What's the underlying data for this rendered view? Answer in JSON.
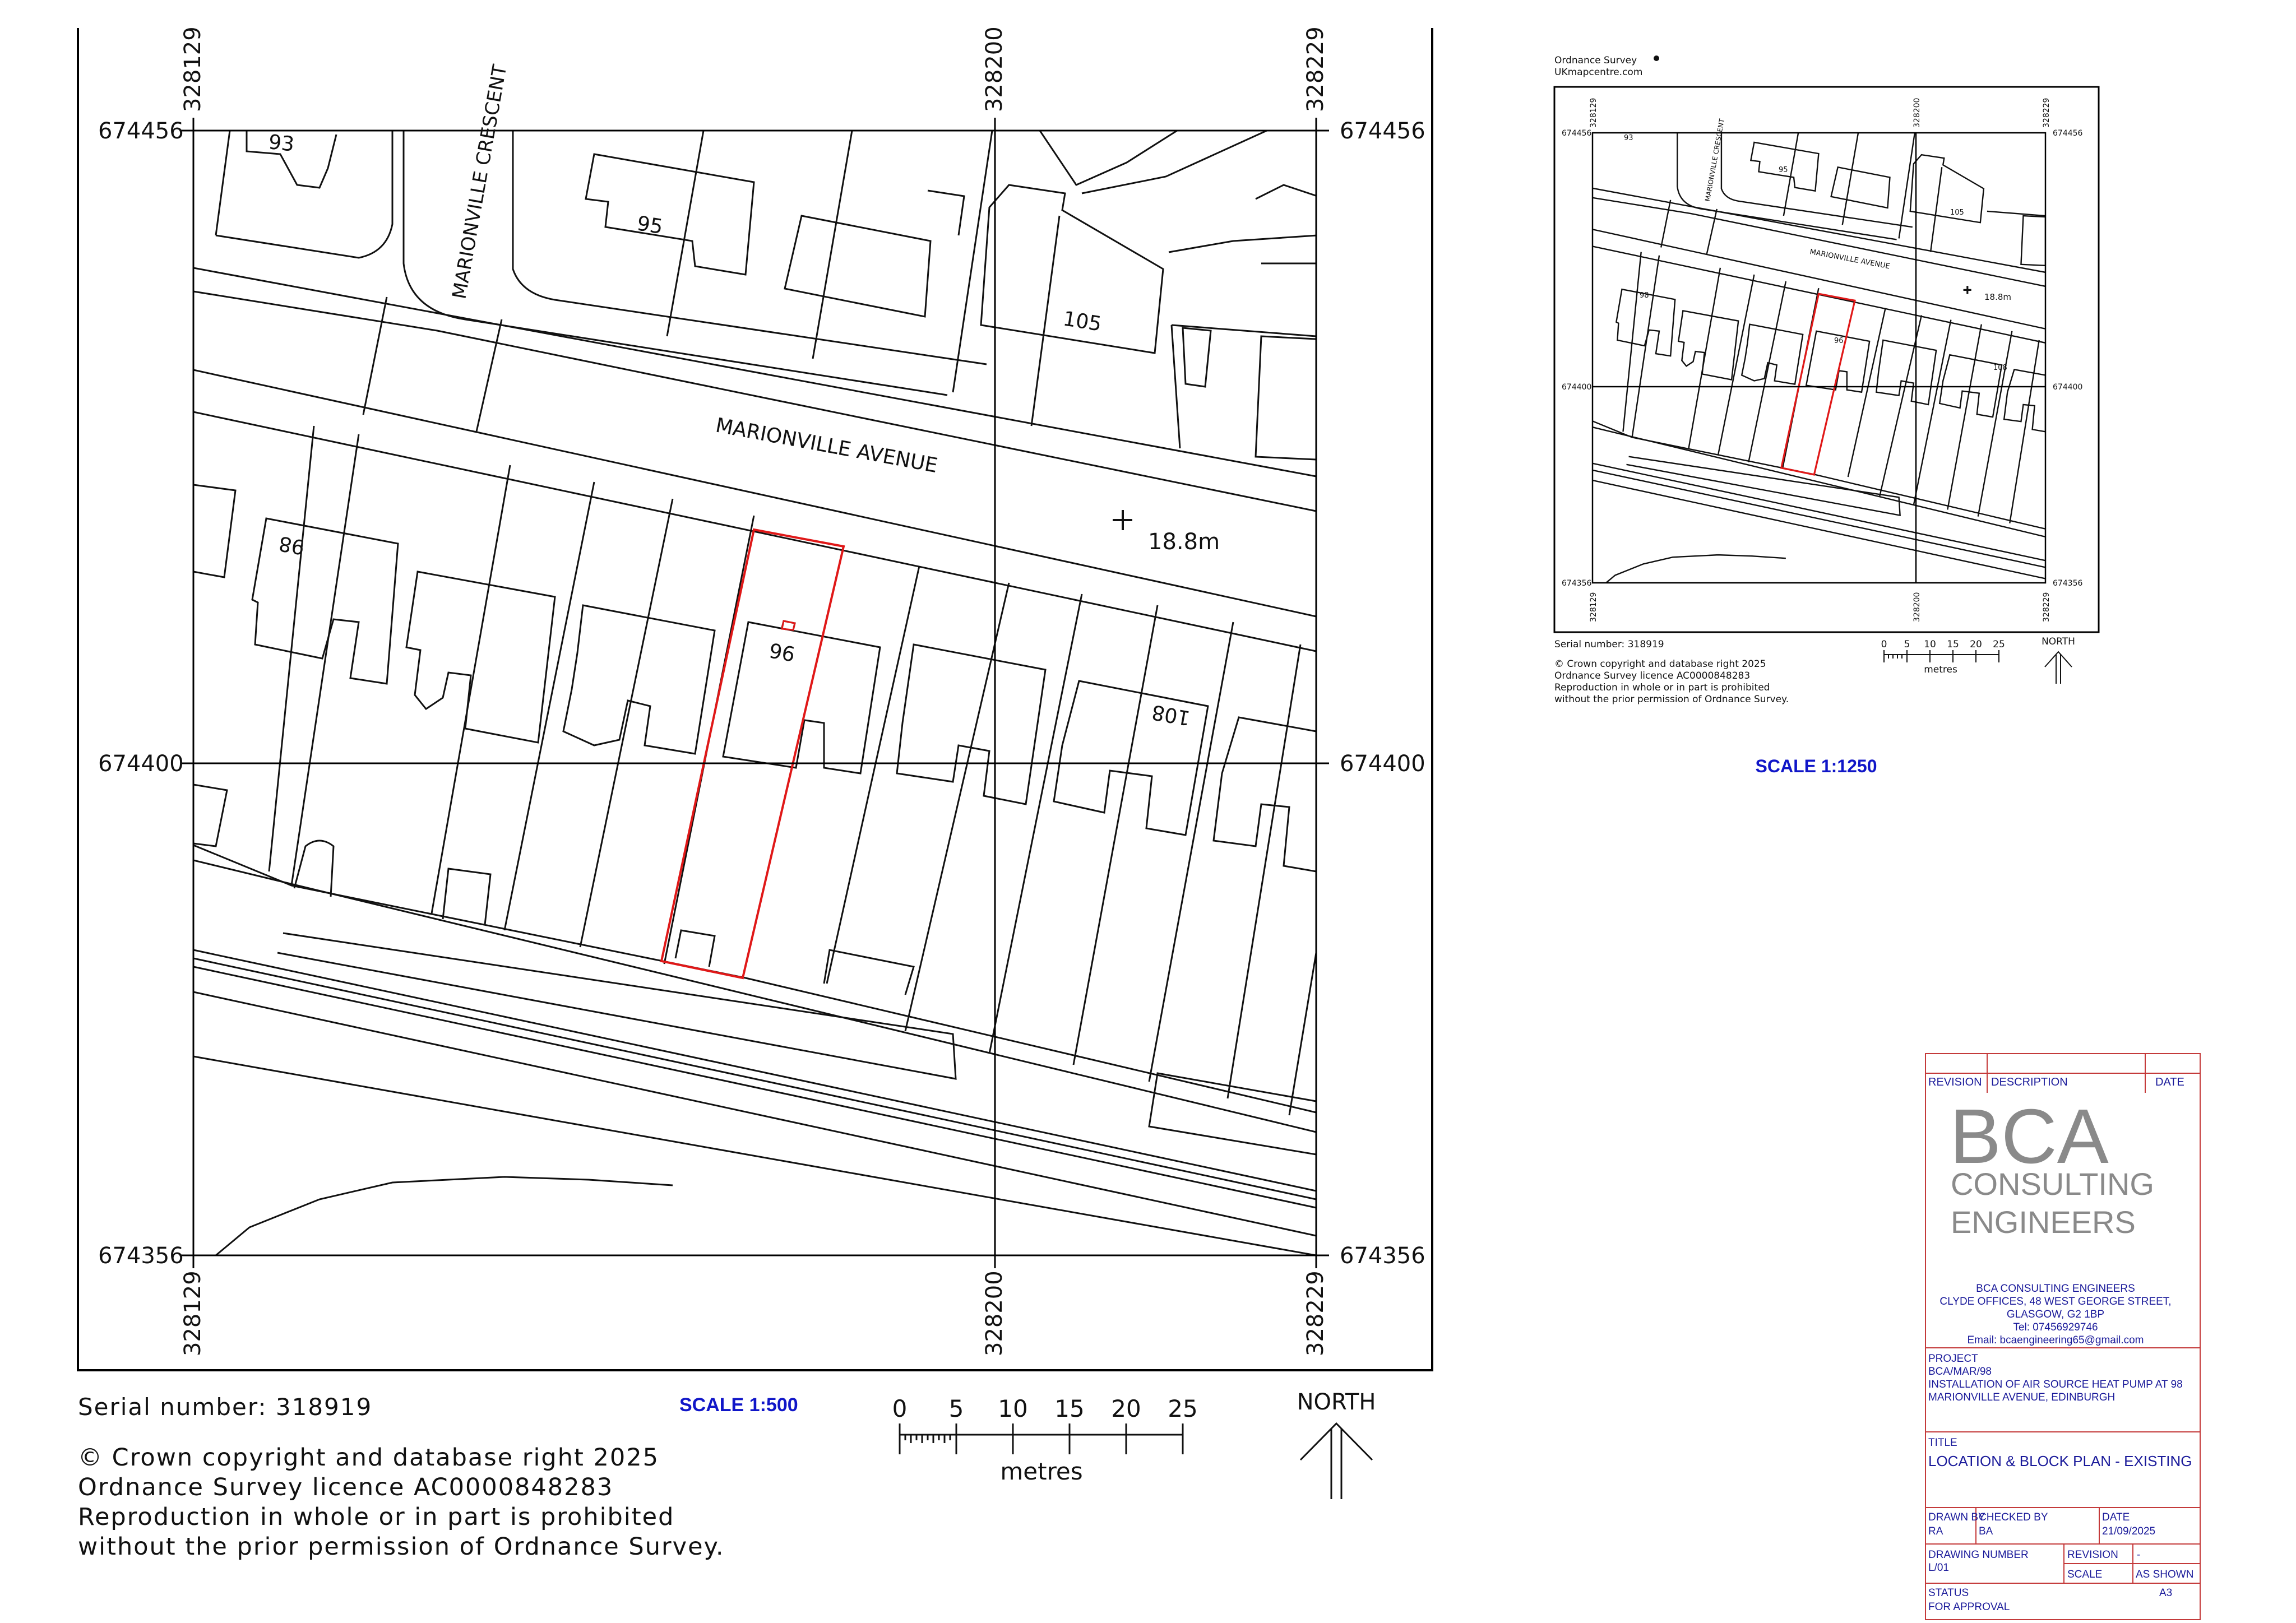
{
  "main_map": {
    "eastings": [
      "328129",
      "328200",
      "328229"
    ],
    "northings": [
      "674456",
      "674400",
      "674356"
    ],
    "street_names": [
      "MARIONVILLE AVENUE",
      "MARIONVILLE CRESCENT"
    ],
    "house_numbers": [
      "93",
      "95",
      "105",
      "98",
      "96",
      "108"
    ],
    "spot_height": "18.8m",
    "serial": "Serial number: 318919",
    "scale_label": "SCALE 1:500",
    "scale_ticks": [
      "0",
      "5",
      "10",
      "15",
      "20",
      "25"
    ],
    "scale_unit": "metres",
    "north": "NORTH",
    "copyright_lines": [
      "© Crown copyright and database right 2025",
      "Ordnance Survey licence AC0000848283",
      "Reproduction in whole or in part is prohibited",
      "without the prior permission of Ordnance Survey."
    ]
  },
  "inset_map": {
    "header_lines": [
      "Ordnance Survey",
      "UKmapcentre.com"
    ],
    "eastings": [
      "328129",
      "328200",
      "328229"
    ],
    "northings": [
      "674456",
      "674400",
      "674356"
    ],
    "street_names": [
      "MARIONVILLE AVENUE",
      "MARIONVILLE CRESCENT"
    ],
    "house_numbers": [
      "93",
      "95",
      "105",
      "98",
      "96",
      "108"
    ],
    "spot_height": "18.8m",
    "serial": "Serial number: 318919",
    "scale_ticks": [
      "0",
      "5",
      "10",
      "15",
      "20",
      "25"
    ],
    "scale_unit": "metres",
    "north": "NORTH",
    "copyright_lines": [
      "© Crown copyright and database right 2025",
      "Ordnance Survey licence AC0000848283",
      "Reproduction in whole or in part is prohibited",
      "without the prior permission of Ordnance Survey."
    ],
    "scale_label": "SCALE 1:1250"
  },
  "title_block": {
    "headers": {
      "revision": "REVISION",
      "description": "DESCRIPTION",
      "date": "DATE"
    },
    "logo": {
      "line1": "BCA",
      "line2": "CONSULTING",
      "line3": "ENGINEERS"
    },
    "company": {
      "name": "BCA CONSULTING ENGINEERS",
      "address1": "CLYDE OFFICES, 48 WEST GEORGE STREET,",
      "address2": "GLASGOW, G2 1BP",
      "tel": "Tel: 07456929746",
      "email": "Email: bcaengineering65@gmail.com"
    },
    "project": {
      "label": "PROJECT",
      "ref": "BCA/MAR/98",
      "line1": "INSTALLATION OF AIR SOURCE HEAT PUMP AT 98",
      "line2": "MARIONVILLE AVENUE, EDINBURGH"
    },
    "title": {
      "label": "TITLE",
      "value": "LOCATION & BLOCK PLAN - EXISTING"
    },
    "drawn_by": {
      "label": "DRAWN BY",
      "value": "RA"
    },
    "checked_by": {
      "label": "CHECKED BY",
      "value": "BA"
    },
    "date": {
      "label": "DATE",
      "value": "21/09/2025"
    },
    "drawing_number": {
      "label": "DRAWING NUMBER",
      "value": "L/01"
    },
    "revision": {
      "label": "REVISION",
      "value": "-"
    },
    "scale": {
      "label": "SCALE",
      "value": "AS SHOWN"
    },
    "status": {
      "label": "STATUS",
      "value": "FOR APPROVAL"
    },
    "sheet_size": "A3"
  },
  "colors": {
    "boundary": "#e01818",
    "blue_text": "#1016c8",
    "title_block_line": "#c43a3a",
    "logo_grey": "#8a8a8a"
  }
}
